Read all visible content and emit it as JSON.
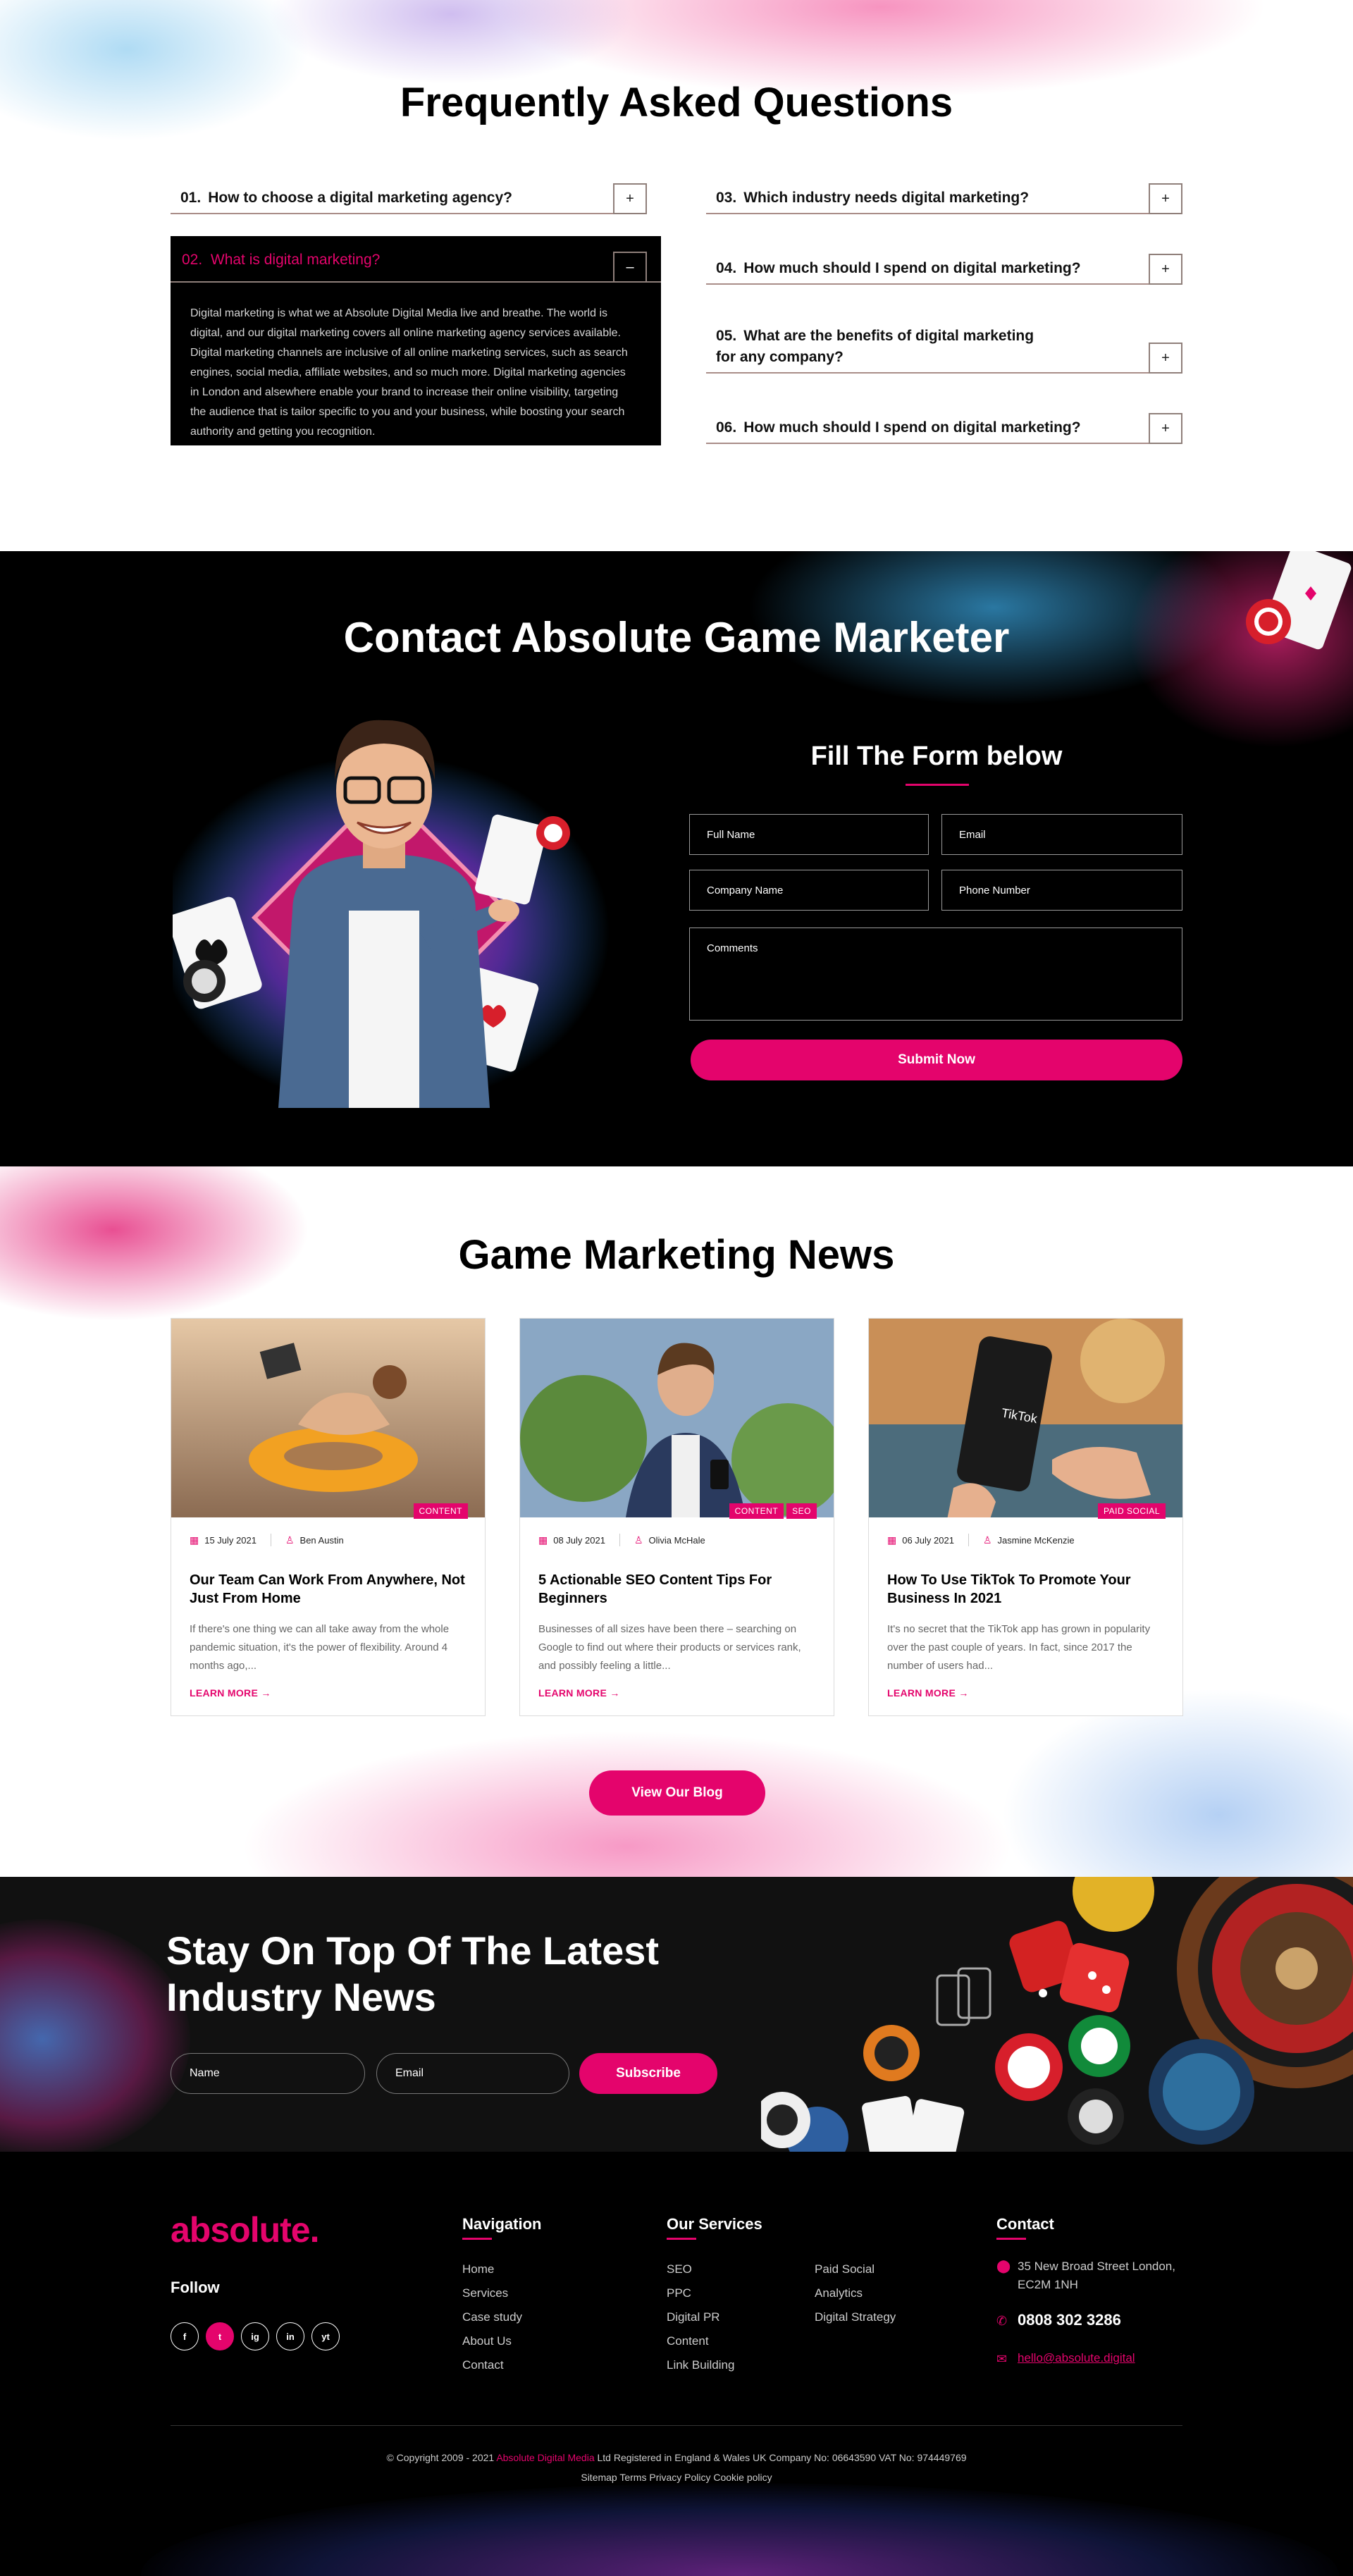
{
  "faq": {
    "title": "Frequently Asked Questions",
    "left_items": [
      {
        "num": "01.",
        "question": "How to choose a digital marketing agency?",
        "toggle": "+"
      }
    ],
    "open_item": {
      "num": "02.",
      "question": "What is digital marketing?",
      "toggle": "–",
      "answer": "Digital marketing is what we at Absolute Digital Media live and breathe. The world is digital, and our digital marketing covers all online marketing agency services available. Digital marketing channels are inclusive of all online marketing services, such as search engines, social media, affiliate websites, and so much more. Digital marketing agencies in London and alsewhere enable your brand to increase their online visibility, targeting the audience that is tailor specific to you and your business, while boosting your search authority and getting you recognition."
    },
    "right_items": [
      {
        "num": "03.",
        "question": "Which industry needs digital marketing?",
        "toggle": "+"
      },
      {
        "num": "04.",
        "question": "How much should I spend on digital marketing?",
        "toggle": "+"
      },
      {
        "num": "05.",
        "question": "What are the benefits of digital marketing for any company?",
        "toggle": "+"
      },
      {
        "num": "06.",
        "question": "How much should I spend on digital marketing?",
        "toggle": "+"
      }
    ]
  },
  "contact": {
    "title": "Contact Absolute Game Marketer",
    "form_title": "Fill The Form below",
    "fields": {
      "full_name": "Full Name",
      "email": "Email",
      "company": "Company Name",
      "phone": "Phone Number",
      "comments": "Comments"
    },
    "submit": "Submit Now"
  },
  "news": {
    "title": "Game Marketing News",
    "cards": [
      {
        "tags": [
          "CONTENT"
        ],
        "date": "15 July 2021",
        "author": "Ben Austin",
        "title": "Our Team Can Work From Anywhere, Not Just From Home",
        "excerpt": "If there's one thing we can all take away from the whole pandemic situation, it's the power of flexibility. Around 4 months ago,...",
        "more": "LEARN MORE"
      },
      {
        "tags": [
          "CONTENT",
          "SEO"
        ],
        "date": "08 July 2021",
        "author": "Olivia McHale",
        "title": "5 Actionable SEO Content Tips For Beginners",
        "excerpt": "Businesses of all sizes have been there – searching on Google to find out where their products or services rank, and possibly feeling a little...",
        "more": "LEARN MORE"
      },
      {
        "tags": [
          "PAID SOCIAL"
        ],
        "date": "06 July 2021",
        "author": "Jasmine McKenzie",
        "title": "How To Use TikTok To Promote Your Business In 2021",
        "excerpt": "It's no secret that the TikTok app has grown in popularity over the past couple of years. In fact, since 2017 the number of users had...",
        "more": "LEARN MORE"
      }
    ],
    "tiktok_label": "TikTok",
    "blog_button": "View Our Blog"
  },
  "newsletter": {
    "title_line1": "Stay On Top Of The Latest",
    "title_line2": "Industry News",
    "name_placeholder": "Name",
    "email_placeholder": "Email",
    "button": "Subscribe"
  },
  "footer": {
    "logo": "absolute.",
    "follow": "Follow",
    "socials": [
      "f",
      "t",
      "ig",
      "in",
      "yt"
    ],
    "navigation": {
      "title": "Navigation",
      "items": [
        "Home",
        "Services",
        "Case study",
        "About Us",
        "Contact"
      ]
    },
    "services": {
      "title": "Our Services",
      "col1": [
        "SEO",
        "PPC",
        "Digital PR",
        "Content",
        "Link Building"
      ],
      "col2": [
        "Paid Social",
        "Analytics",
        "Digital Strategy"
      ]
    },
    "contact": {
      "title": "Contact",
      "address": "35 New Broad Street London, EC2M 1NH",
      "phone": "0808 302 3286",
      "email": "hello@absolute.digital"
    },
    "copyright_pre": "© Copyright 2009 - 2021 ",
    "copyright_brand": "Absolute Digital Media",
    "copyright_post": " Ltd Registered in England & Wales UK Company No: 06643590 VAT No: 974449769",
    "links": "Sitemap Terms Privacy Policy Cookie policy"
  },
  "colors": {
    "accent": "#e4046c",
    "dark": "#000000",
    "border": "#8f7f7a"
  }
}
